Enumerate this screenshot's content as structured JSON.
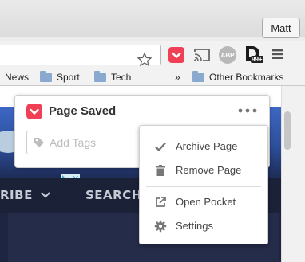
{
  "window": {
    "profile_name": "Matt"
  },
  "toolbar": {
    "icons": [
      "star-icon",
      "pocket-icon",
      "cast-icon",
      "adblock-plus-icon",
      "disconnect-icon",
      "hamburger-menu-icon"
    ],
    "abp_label": "ABP",
    "disconnect_count": "99+"
  },
  "bookmarks": {
    "items": [
      {
        "label": "News"
      },
      {
        "label": "Sport"
      },
      {
        "label": "Tech"
      }
    ],
    "overflow_label": "»",
    "other_label": "Other Bookmarks"
  },
  "page": {
    "nav_text_left": "RIBE",
    "nav_text_right": "SEARCH",
    "ad_close": "✕"
  },
  "pocket": {
    "title": "Page Saved",
    "tags_placeholder": "Add Tags",
    "brand_color": "#ef4056",
    "menu": {
      "items": [
        {
          "label": "Archive Page",
          "icon": "checkmark-icon"
        },
        {
          "label": "Remove Page",
          "icon": "trash-icon"
        },
        {
          "label": "Open Pocket",
          "icon": "external-link-icon"
        },
        {
          "label": "Settings",
          "icon": "gear-icon"
        }
      ]
    }
  }
}
